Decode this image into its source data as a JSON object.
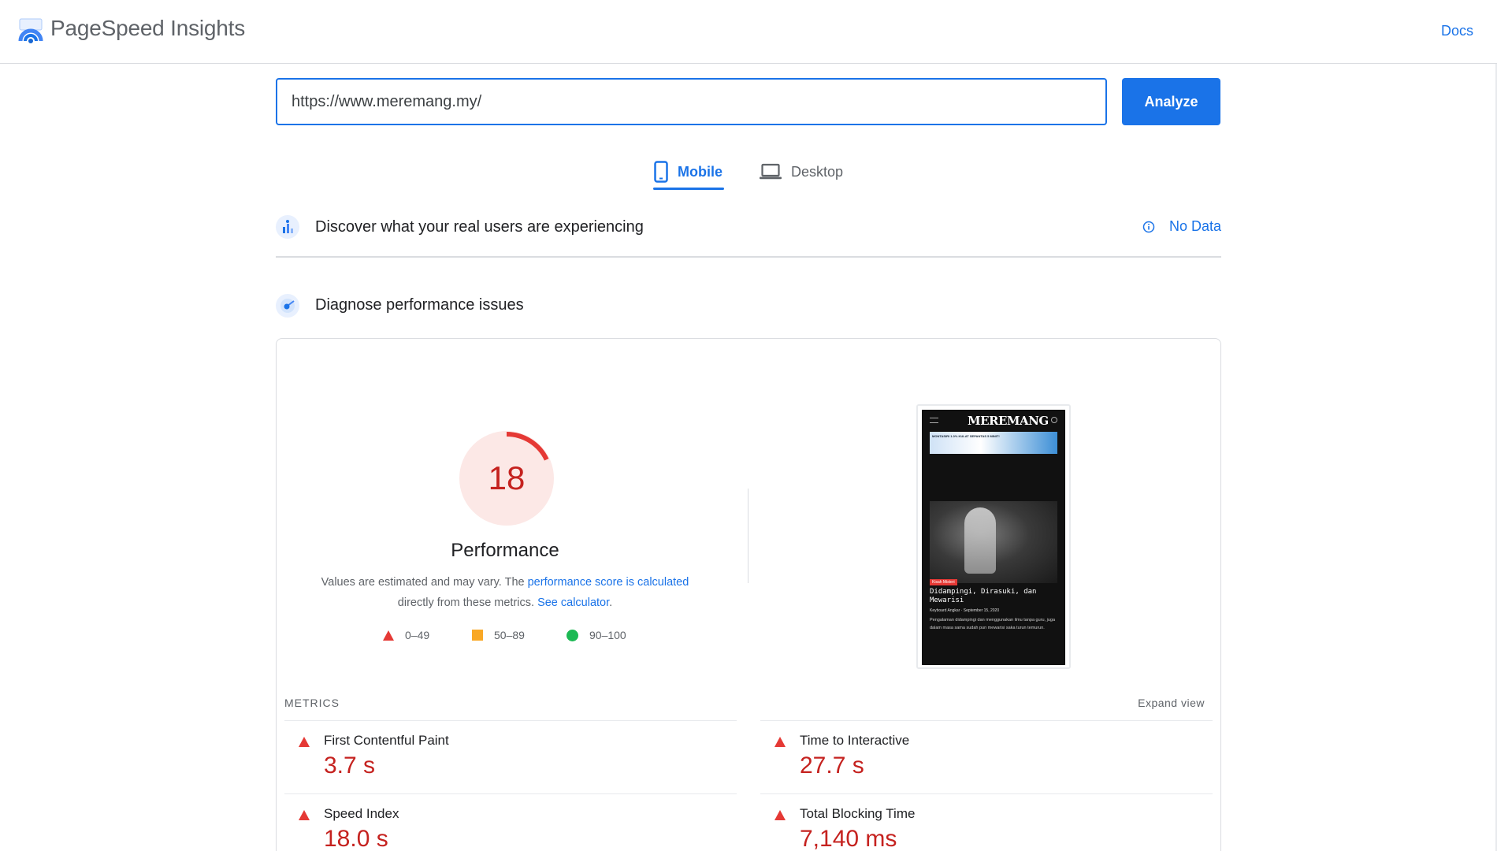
{
  "header": {
    "app_title": "PageSpeed Insights",
    "docs_label": "Docs",
    "logo_icon": "pagespeed-logo-icon"
  },
  "search": {
    "url_value": "https://www.meremang.my/",
    "analyze_label": "Analyze"
  },
  "device_tabs": [
    {
      "label": "Mobile",
      "icon": "mobile-phone-icon",
      "selected": true
    },
    {
      "label": "Desktop",
      "icon": "laptop-icon",
      "selected": false
    }
  ],
  "field_data": {
    "title": "Discover what your real users are experiencing",
    "status": "No Data",
    "icon": "users-chart-icon"
  },
  "lab_data": {
    "title": "Diagnose performance issues",
    "icon": "lighthouse-icon",
    "score": "18",
    "score_fraction": 0.18,
    "category_label": "Performance",
    "note_prefix": "Values are estimated and may vary. The ",
    "note_link1": "performance score is calculated",
    "note_middle": " directly from these metrics. ",
    "note_link2": "See calculator",
    "note_suffix": ".",
    "legend": [
      {
        "range": "0–49",
        "shape": "triangle",
        "color": "#e53935"
      },
      {
        "range": "50–89",
        "shape": "square",
        "color": "#f9a825"
      },
      {
        "range": "90–100",
        "shape": "circle",
        "color": "#1db954"
      }
    ]
  },
  "thumbnail": {
    "site_logo": "MEREMANG",
    "ad_text": "MONTASIRI 1.0% KULAT SEPANTAS 5 MINIT!",
    "category_tag": "Kisah Misteri",
    "headline": "Didampingi, Dirasuki, dan Mewarisi",
    "meta": "Keyboard Angkar · September 15, 2020",
    "excerpt": "Pengalaman didampingi dan menggunakan ilmu tanpa guru, juga dalam masa sama sudah pun mewarisi saka turun temurun."
  },
  "metrics": {
    "heading": "METRICS",
    "expand_label": "Expand view",
    "items": [
      {
        "name": "First Contentful Paint",
        "value": "3.7 s",
        "rating": "fail"
      },
      {
        "name": "Time to Interactive",
        "value": "27.7 s",
        "rating": "fail"
      },
      {
        "name": "Speed Index",
        "value": "18.0 s",
        "rating": "fail"
      },
      {
        "name": "Total Blocking Time",
        "value": "7,140 ms",
        "rating": "fail"
      }
    ]
  },
  "colors": {
    "accent": "#1a73e8",
    "fail": "#c5221f",
    "fail_marker": "#e53935",
    "gauge_bg": "#fce8e6"
  }
}
